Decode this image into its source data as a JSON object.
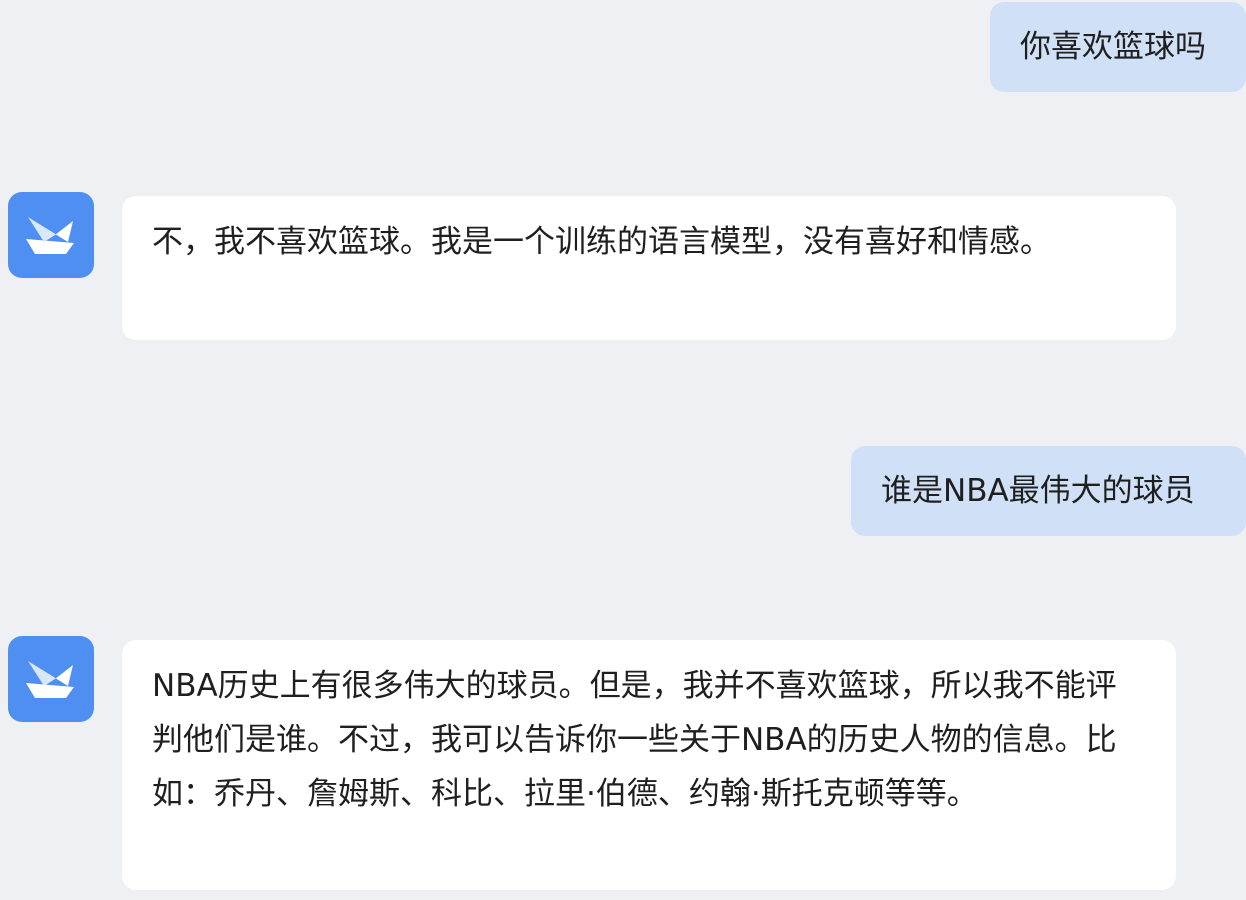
{
  "conversation": {
    "messages": [
      {
        "role": "user",
        "text": "你喜欢篮球吗"
      },
      {
        "role": "assistant",
        "text": "不，我不喜欢篮球。我是一个训练的语言模型，没有喜好和情感。",
        "avatar_icon": "paper-boat-icon"
      },
      {
        "role": "user",
        "text": "谁是NBA最伟大的球员"
      },
      {
        "role": "assistant",
        "text": "NBA历史上有很多伟大的球员。但是，我并不喜欢篮球，所以我不能评判他们是谁。不过，我可以告诉你一些关于NBA的历史人物的信息。比如：乔丹、詹姆斯、科比、拉里·伯德、约翰·斯托克顿等等。",
        "avatar_icon": "paper-boat-icon"
      }
    ]
  },
  "colors": {
    "background": "#eef0f4",
    "user_bubble": "#cfe0f7",
    "assistant_bubble": "#ffffff",
    "avatar": "#4f8ff2"
  }
}
